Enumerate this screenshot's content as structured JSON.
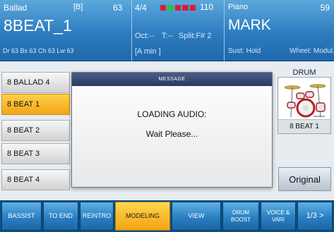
{
  "header": {
    "style_category": "Ballad",
    "bank": "[B]",
    "style_number": "63",
    "style_name": "8BEAT_1",
    "volumes": "Dr 63  Bs 63  Ch 63  Lw 63",
    "time_signature": "4/4",
    "tempo": "110",
    "octave": "Oct:--",
    "transpose": "T:--",
    "split": "Split:F# 2",
    "chord": "[A min        ]",
    "voice_category": "Piano",
    "voice_number": "59",
    "voice_name": "MARK",
    "sustain": "Sust: Hold",
    "wheel": "Wheel: Modul."
  },
  "beat_indicator": [
    "red",
    "green",
    "red",
    "red",
    "red"
  ],
  "style_list": [
    {
      "label": "8 BALLAD 4",
      "selected": false
    },
    {
      "label": "8 BEAT 1",
      "selected": true
    },
    {
      "label": "8 BEAT 2",
      "selected": false
    },
    {
      "label": "8 BEAT 3",
      "selected": false
    },
    {
      "label": "8 BEAT 4",
      "selected": false
    }
  ],
  "drum_panel": {
    "title": "DRUM",
    "kit_name": "8 BEAT 1"
  },
  "original_button": "Original",
  "dialog": {
    "title": "MESSAGE",
    "line1": "LOADING AUDIO:",
    "line2": "Wait Please..."
  },
  "bottom_buttons": [
    {
      "label": "BASSIST",
      "active": false
    },
    {
      "label": "TO END",
      "active": false
    },
    {
      "label": "REINTRO",
      "active": false
    },
    {
      "label": "MODELING",
      "active": true
    },
    {
      "label": "VIEW",
      "active": false
    },
    {
      "label": "DRUM BOOST",
      "active": false
    },
    {
      "label": "VOICE & VARI",
      "active": false
    },
    {
      "label": "1/3 >",
      "active": false
    }
  ],
  "colors": {
    "accent": "#f3a515",
    "header_blue": "#2d7cc0",
    "dialog_bar": "#2a3a60"
  }
}
